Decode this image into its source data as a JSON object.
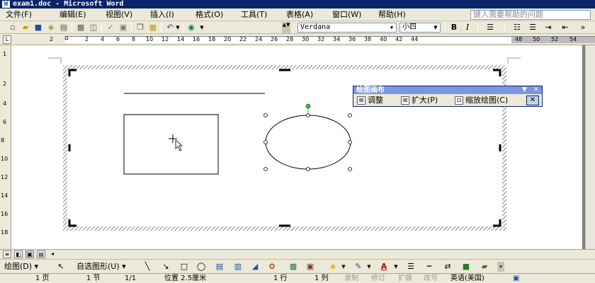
{
  "window": {
    "title": "exam1.doc - Microsoft Word",
    "icon": "W"
  },
  "menu": {
    "items": [
      "文件(F)",
      "编辑(E)",
      "视图(V)",
      "插入(I)",
      "格式(O)",
      "工具(T)",
      "表格(A)",
      "窗口(W)",
      "帮助(H)"
    ],
    "help_placeholder": "键入需要帮助的问题"
  },
  "toolbar": {
    "font_name": "Verdana",
    "font_size": "小四",
    "bold": "B",
    "italic": "I"
  },
  "ruler": {
    "corner": "L",
    "numbers": [
      "2",
      "2",
      "4",
      "6",
      "8",
      "10",
      "12",
      "14",
      "16",
      "18",
      "20",
      "22",
      "24",
      "26",
      "28",
      "30",
      "32",
      "34",
      "36",
      "38",
      "40",
      "42",
      "44",
      "48",
      "50",
      "52",
      "54"
    ],
    "vnumbers": [
      "1",
      "2",
      "4",
      "6",
      "8",
      "10",
      "12",
      "14",
      "16",
      "18"
    ]
  },
  "canvas_toolbar": {
    "title": "绘图画布",
    "fit": "调整",
    "expand": "扩大(P)",
    "scale": "缩放绘图(C)"
  },
  "drawing_toolbar": {
    "draw_menu": "绘图(D)",
    "autoshapes_menu": "自选图形(U)"
  },
  "status": {
    "page": "1 页",
    "section": "1 节",
    "page_of": "1/1",
    "position": "位置 2.5厘米",
    "line": "1 行",
    "column": "1 列",
    "rec": "录制",
    "trk": "修订",
    "ext": "扩展",
    "ovr": "改写",
    "language": "英语(美国)"
  },
  "colors": {
    "title_bar": "#0a246a",
    "chrome": "#ece9d8",
    "selection_handle": "#000000",
    "rotate_handle": "#39b54a"
  }
}
